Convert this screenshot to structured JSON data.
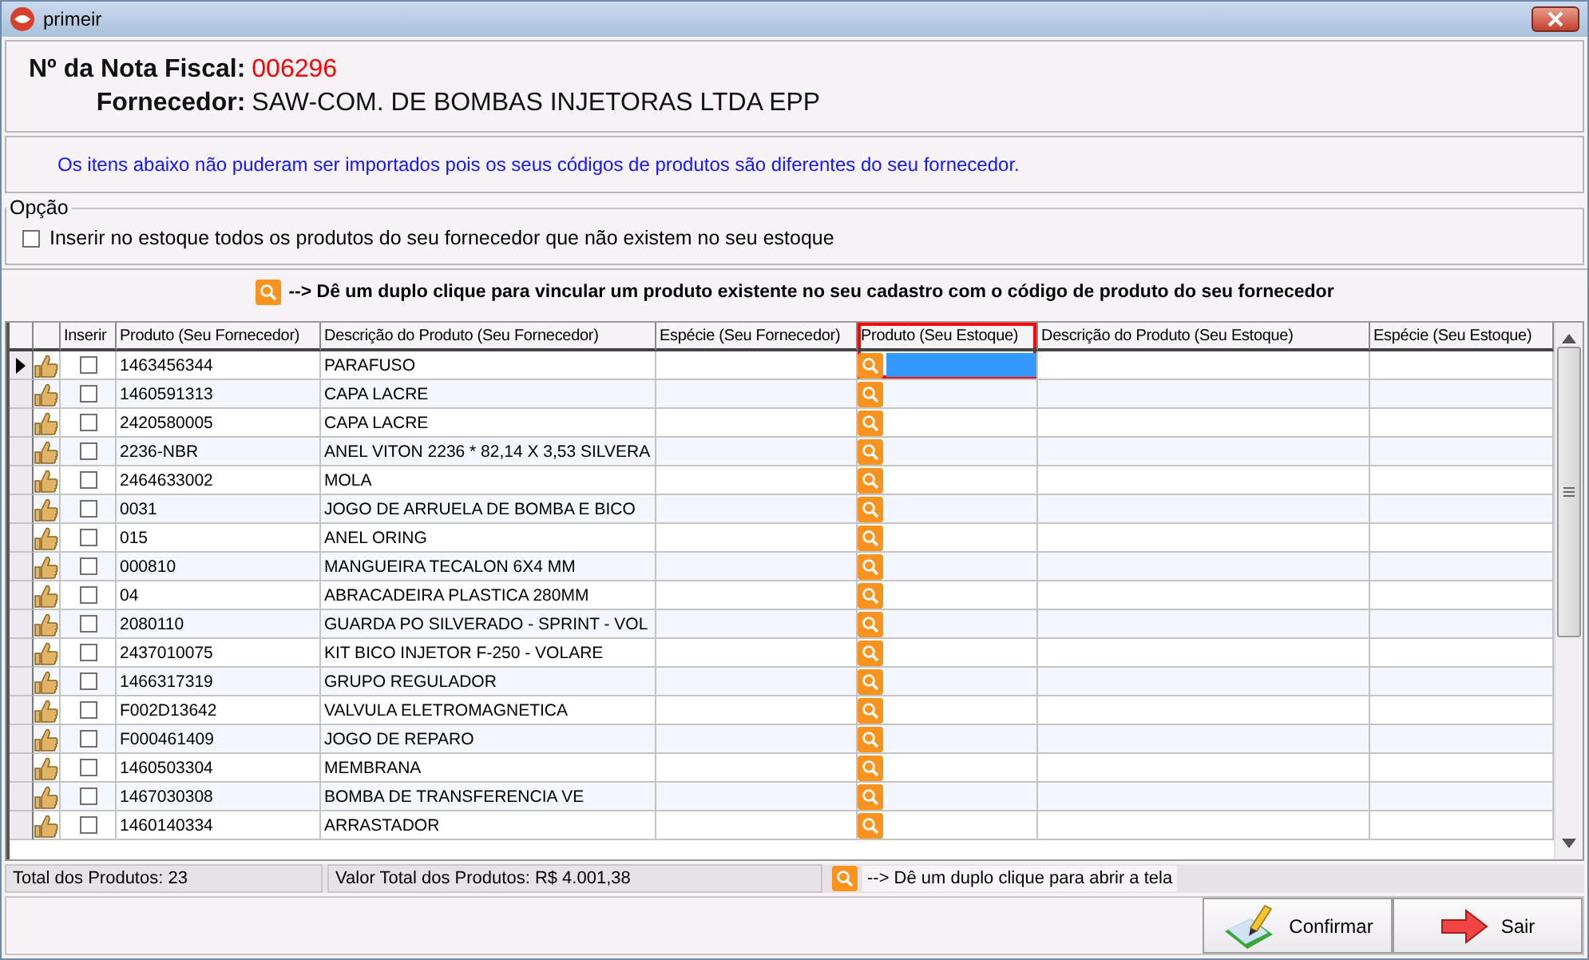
{
  "window": {
    "title": "primeir"
  },
  "header": {
    "invoice_label": "Nº da Nota Fiscal:",
    "invoice_number": "006296",
    "supplier_label": "Fornecedor:",
    "supplier_name": "SAW-COM. DE BOMBAS INJETORAS LTDA EPP"
  },
  "message": "Os itens abaixo não puderam ser importados pois os seus códigos de produtos são diferentes do seu fornecedor.",
  "option_group": {
    "title": "Opção",
    "checkbox": {
      "label": "Inserir no estoque todos os produtos do seu fornecedor que não existem no seu estoque",
      "checked": false
    }
  },
  "hint": "--> Dê um duplo clique para vincular um produto existente no seu cadastro com o código de produto do seu fornecedor",
  "grid": {
    "columns": [
      {
        "label": "Inserir",
        "highlighted": false
      },
      {
        "label": "Produto (Seu Fornecedor)",
        "highlighted": false
      },
      {
        "label": "Descrição do Produto (Seu Fornecedor)",
        "highlighted": false
      },
      {
        "label": "Espécie (Seu Fornecedor)",
        "highlighted": false
      },
      {
        "label": "Produto (Seu Estoque)",
        "highlighted": true
      },
      {
        "label": "Descrição do Produto (Seu Estoque)",
        "highlighted": false
      },
      {
        "label": "Espécie (Seu Estoque)",
        "highlighted": false
      }
    ],
    "rows": [
      {
        "code": "1463456344",
        "description": "PARAFUSO",
        "checked": false,
        "selected": true
      },
      {
        "code": "1460591313",
        "description": "CAPA LACRE",
        "checked": false,
        "selected": false
      },
      {
        "code": "2420580005",
        "description": "CAPA LACRE",
        "checked": false,
        "selected": false
      },
      {
        "code": "2236-NBR",
        "description": "ANEL VITON 2236 * 82,14 X 3,53 SILVERA",
        "checked": false,
        "selected": false
      },
      {
        "code": "2464633002",
        "description": "MOLA",
        "checked": false,
        "selected": false
      },
      {
        "code": "0031",
        "description": "JOGO DE ARRUELA DE BOMBA E BICO",
        "checked": false,
        "selected": false
      },
      {
        "code": "015",
        "description": "ANEL ORING",
        "checked": false,
        "selected": false
      },
      {
        "code": "000810",
        "description": "MANGUEIRA TECALON 6X4 MM",
        "checked": false,
        "selected": false
      },
      {
        "code": "04",
        "description": "ABRACADEIRA PLASTICA 280MM",
        "checked": false,
        "selected": false
      },
      {
        "code": "2080110",
        "description": "GUARDA PO SILVERADO - SPRINT - VOL",
        "checked": false,
        "selected": false
      },
      {
        "code": "2437010075",
        "description": "KIT BICO INJETOR F-250 - VOLARE",
        "checked": false,
        "selected": false
      },
      {
        "code": "1466317319",
        "description": "GRUPO REGULADOR",
        "checked": false,
        "selected": false
      },
      {
        "code": "F002D13642",
        "description": "VALVULA ELETROMAGNETICA",
        "checked": false,
        "selected": false
      },
      {
        "code": "F000461409",
        "description": "JOGO DE REPARO",
        "checked": false,
        "selected": false
      },
      {
        "code": "1460503304",
        "description": "MEMBRANA",
        "checked": false,
        "selected": false
      },
      {
        "code": "1467030308",
        "description": "BOMBA DE TRANSFERENCIA VE",
        "checked": false,
        "selected": false
      },
      {
        "code": "1460140334",
        "description": "ARRASTADOR",
        "checked": false,
        "selected": false
      }
    ]
  },
  "status_bar": {
    "total_products": "Total dos Produtos: 23",
    "total_value": "Valor Total dos Produtos: R$ 4.001,38",
    "hint": "--> Dê um duplo clique para abrir a tela"
  },
  "buttons": [
    {
      "label": "Confirmar",
      "kind": "confirm"
    },
    {
      "label": "Sair",
      "kind": "exit"
    }
  ]
}
